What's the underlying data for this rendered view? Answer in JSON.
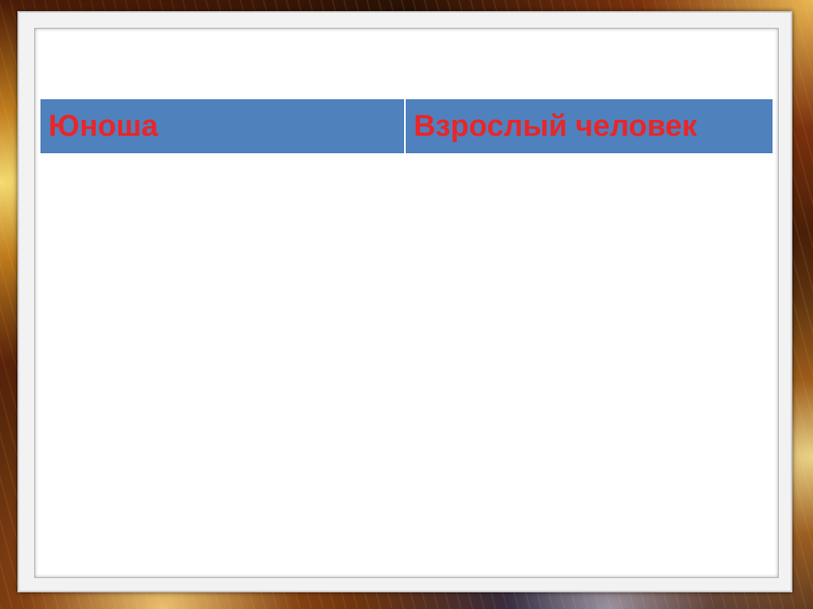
{
  "slide": {
    "table": {
      "headers": [
        "Юноша",
        "Взрослый человек"
      ],
      "rows": []
    }
  },
  "colors": {
    "header_fill": "#4f81bd",
    "header_text": "#e8262a",
    "slide_bg": "#ffffff"
  }
}
